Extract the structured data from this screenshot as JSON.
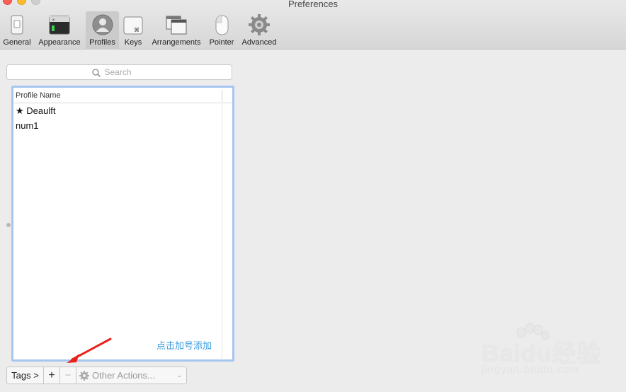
{
  "window": {
    "title": "Preferences"
  },
  "toolbar": {
    "items": [
      {
        "label": "General",
        "icon": "switch-icon",
        "selected": false
      },
      {
        "label": "Appearance",
        "icon": "terminal-window-icon",
        "selected": false
      },
      {
        "label": "Profiles",
        "icon": "person-icon",
        "selected": true
      },
      {
        "label": "Keys",
        "icon": "command-key-icon",
        "selected": false
      },
      {
        "label": "Arrangements",
        "icon": "windows-icon",
        "selected": false
      },
      {
        "label": "Pointer",
        "icon": "mouse-icon",
        "selected": false
      },
      {
        "label": "Advanced",
        "icon": "gear-icon",
        "selected": false
      }
    ]
  },
  "search": {
    "placeholder": "Search",
    "value": ""
  },
  "profiles_table": {
    "column_header": "Profile Name",
    "rows": [
      {
        "name": "★ Deaulft"
      },
      {
        "name": "num1"
      }
    ]
  },
  "annotation": {
    "hint": "点击加号添加",
    "color": "#3a9ce0",
    "arrow_color": "#e8231c"
  },
  "bottom_bar": {
    "tags_label": "Tags >",
    "add_label": "+",
    "remove_label": "−",
    "other_actions_label": "Other Actions..."
  },
  "watermark": {
    "brand": "Baidu经验",
    "url": "jingyan.baidu.com"
  },
  "colors": {
    "selection_border": "#a7c6ef",
    "accent": "#3a9ce0"
  }
}
